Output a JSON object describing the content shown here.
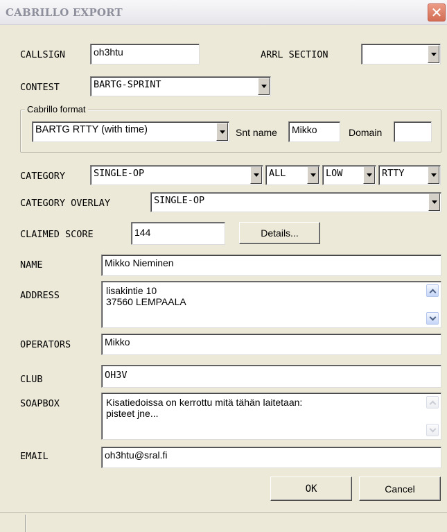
{
  "window": {
    "title": "CABRILLO EXPORT",
    "close_glyph": "✕"
  },
  "fields": {
    "callsign": {
      "label": "CALLSIGN",
      "value": "oh3htu"
    },
    "arrl_section": {
      "label": "ARRL SECTION",
      "value": ""
    },
    "contest": {
      "label": "CONTEST",
      "value": "BARTG-SPRINT"
    },
    "cabrillo_format": {
      "group_label": "Cabrillo format",
      "format_value": "BARTG RTTY (with time)",
      "snt_name_label": "Snt name",
      "snt_name_value": "Mikko",
      "domain_label": "Domain",
      "domain_value": ""
    },
    "category": {
      "label": "CATEGORY",
      "operator": "SINGLE-OP",
      "band": "ALL",
      "power": "LOW",
      "mode": "RTTY"
    },
    "category_overlay": {
      "label": "CATEGORY OVERLAY",
      "value": "SINGLE-OP"
    },
    "claimed_score": {
      "label": "CLAIMED SCORE",
      "value": "144",
      "details_button": "Details..."
    },
    "name": {
      "label": "NAME",
      "value": "Mikko Nieminen"
    },
    "address": {
      "label": "ADDRESS",
      "line1": "lisakintie 10",
      "line2": "37560 LEMPAALA"
    },
    "operators": {
      "label": "OPERATORS",
      "value": "Mikko"
    },
    "club": {
      "label": "CLUB",
      "value": "OH3V"
    },
    "soapbox": {
      "label": "SOAPBOX",
      "line1": "Kisatiedoissa on kerrottu mitä tähän laitetaan:",
      "line2": "pisteet jne..."
    },
    "email": {
      "label": "EMAIL",
      "value": "oh3htu@sral.fi"
    }
  },
  "buttons": {
    "ok": "OK",
    "cancel": "Cancel"
  },
  "colors": {
    "window_bg": "#ece9d8",
    "close_button": "#d9755d",
    "title_text": "#8e8f9c"
  },
  "icons": {
    "dropdown": "chevron-down-icon",
    "scroll_up": "chevron-up-icon",
    "scroll_down": "chevron-down-icon",
    "close": "close-icon"
  }
}
